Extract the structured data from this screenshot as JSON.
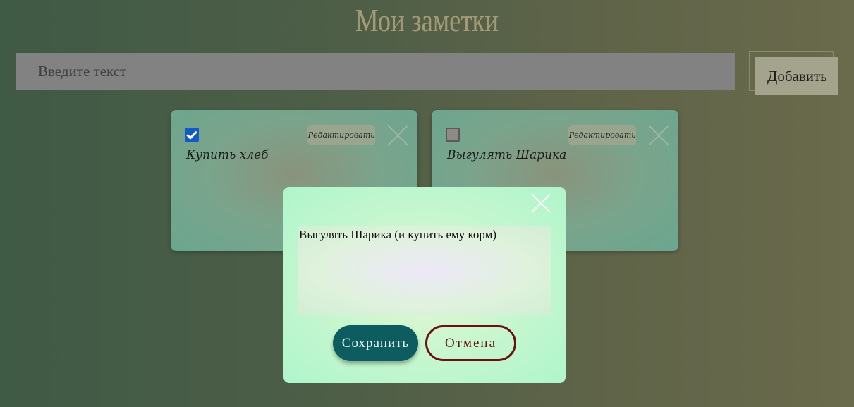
{
  "header": {
    "title": "Мои заметки"
  },
  "add_form": {
    "placeholder": "Введите текст",
    "add_label": "Добавить"
  },
  "notes": [
    {
      "text": "Купить хлеб",
      "checked": true,
      "edit_label": "Редактировать"
    },
    {
      "text": "Выгулять Шарика",
      "checked": false,
      "edit_label": "Редактировать"
    }
  ],
  "edit_modal": {
    "textarea_value": "Выгулять Шарика (и купить ему корм)",
    "save_label": "Сохранить",
    "cancel_label": "Отмена"
  },
  "colors": {
    "checkbox_checked": "#1559c5",
    "save_button": "#0d5c5f",
    "cancel_border": "#6b0f0f"
  },
  "icons": [
    "checkbox-checked-icon",
    "checkbox-unchecked-icon",
    "close-icon"
  ]
}
